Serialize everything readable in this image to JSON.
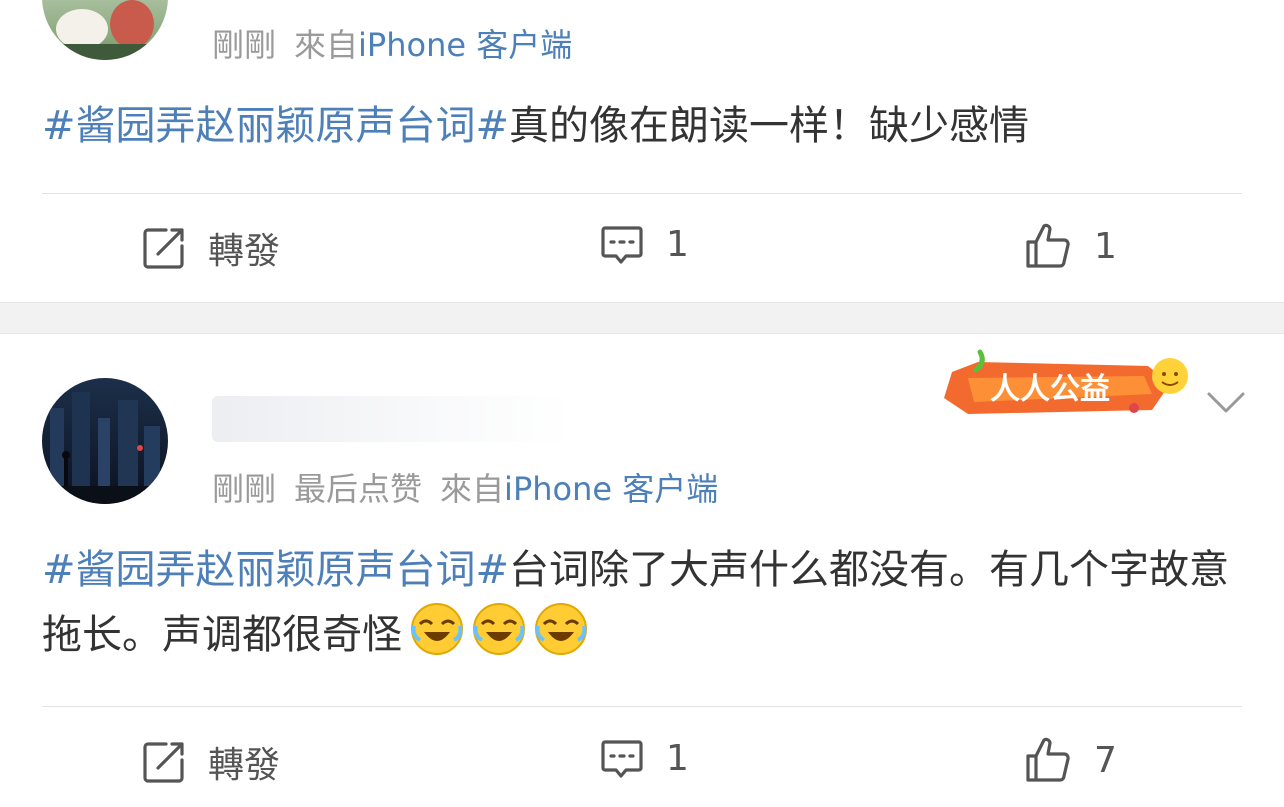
{
  "posts": [
    {
      "meta": {
        "time": "剛剛",
        "from_prefix": "來自",
        "client": "iPhone 客户端"
      },
      "content": {
        "topic": "#酱园弄赵丽颖原声台词#",
        "text": "真的像在朗读一样！缺少感情"
      },
      "actions": {
        "repost": "轉發",
        "comments": "1",
        "likes": "1"
      }
    },
    {
      "meta": {
        "time": "剛剛",
        "liked": "最后点赞",
        "from_prefix": "來自",
        "client": "iPhone 客户端"
      },
      "badge": "人人公益",
      "content": {
        "topic": "#酱园弄赵丽颖原声台词#",
        "text": "台词除了大声什么都没有。有几个字故意拖长。声调都很奇怪"
      },
      "emojis": [
        "laughing-crying-emoji",
        "laughing-crying-emoji",
        "laughing-crying-emoji"
      ],
      "actions": {
        "repost": "轉發",
        "comments": "1",
        "likes": "7"
      }
    }
  ],
  "colors": {
    "link": "#4d7fb8",
    "text": "#333333",
    "meta": "#9a9a9a",
    "separator": "#f2f2f2"
  }
}
